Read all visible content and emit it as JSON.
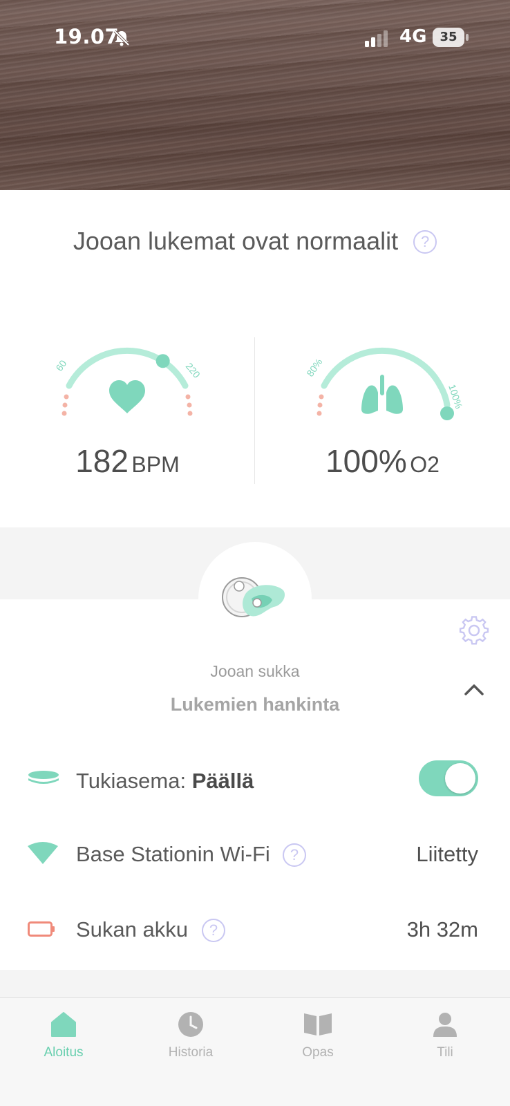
{
  "status_bar": {
    "time": "19.07",
    "network": "4G",
    "battery_level": "35",
    "silent_icon": "bell-slash-icon",
    "signal_icon": "signal-bars-icon"
  },
  "headline": {
    "text": "Jooan lukemat ovat normaalit",
    "help": "?"
  },
  "heart_gauge": {
    "icon": "heart-icon",
    "min_label": "60",
    "max_label": "220",
    "value": "182",
    "unit": "BPM",
    "level_fraction": 0.76
  },
  "oxygen_gauge": {
    "icon": "lungs-icon",
    "min_label": "80%",
    "max_label": "100%",
    "value": "100%",
    "unit": "O2",
    "level_fraction": 1.0
  },
  "sock": {
    "name": "Jooan sukka",
    "status": "Lukemien hankinta",
    "settings_icon": "gear-icon",
    "collapse_icon": "chevron-up-icon"
  },
  "rows": {
    "base": {
      "label": "Tukiasema:",
      "value": "Päällä",
      "icon": "base-station-icon",
      "toggle_on": true
    },
    "wifi": {
      "label": "Base Stationin Wi-Fi",
      "help": "?",
      "value": "Liitetty",
      "icon": "wifi-icon"
    },
    "battery": {
      "label": "Sukan akku",
      "help": "?",
      "value": "3h 32m",
      "icon": "battery-icon"
    }
  },
  "tabs": [
    {
      "label": "Aloitus",
      "icon": "home-icon",
      "active": true
    },
    {
      "label": "Historia",
      "icon": "clock-icon",
      "active": false
    },
    {
      "label": "Opas",
      "icon": "book-icon",
      "active": false
    },
    {
      "label": "Tili",
      "icon": "user-icon",
      "active": false
    }
  ],
  "colors": {
    "accent": "#7fd7bc",
    "warning_dots": "#f4b3a6",
    "help": "#c9c7f2",
    "battery_icon": "#f08a7a"
  }
}
